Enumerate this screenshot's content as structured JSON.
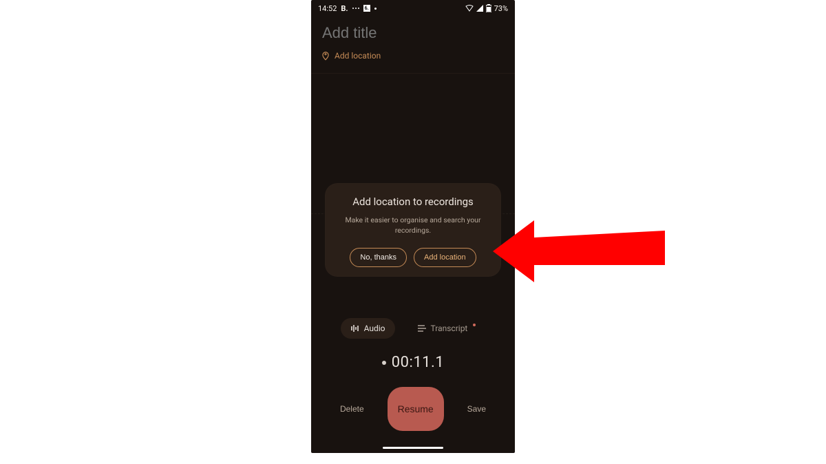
{
  "statusbar": {
    "time": "14:52",
    "indicator_b": "B.",
    "indicator_sq": "6.",
    "battery_text": "73%"
  },
  "title": {
    "placeholder": "Add title",
    "location_label": "Add location"
  },
  "card": {
    "title": "Add location to recordings",
    "body_line1": "Make it easier to organise and search your",
    "body_line2": "recordings.",
    "no_label": "No, thanks",
    "add_label": "Add location"
  },
  "tabs": {
    "audio": "Audio",
    "transcript": "Transcript"
  },
  "timer": {
    "display": "00:11.1"
  },
  "bottom": {
    "delete": "Delete",
    "resume": "Resume",
    "save": "Save"
  },
  "annotation": {
    "type": "arrow",
    "target": "add-location-button",
    "color": "#ff0000"
  }
}
